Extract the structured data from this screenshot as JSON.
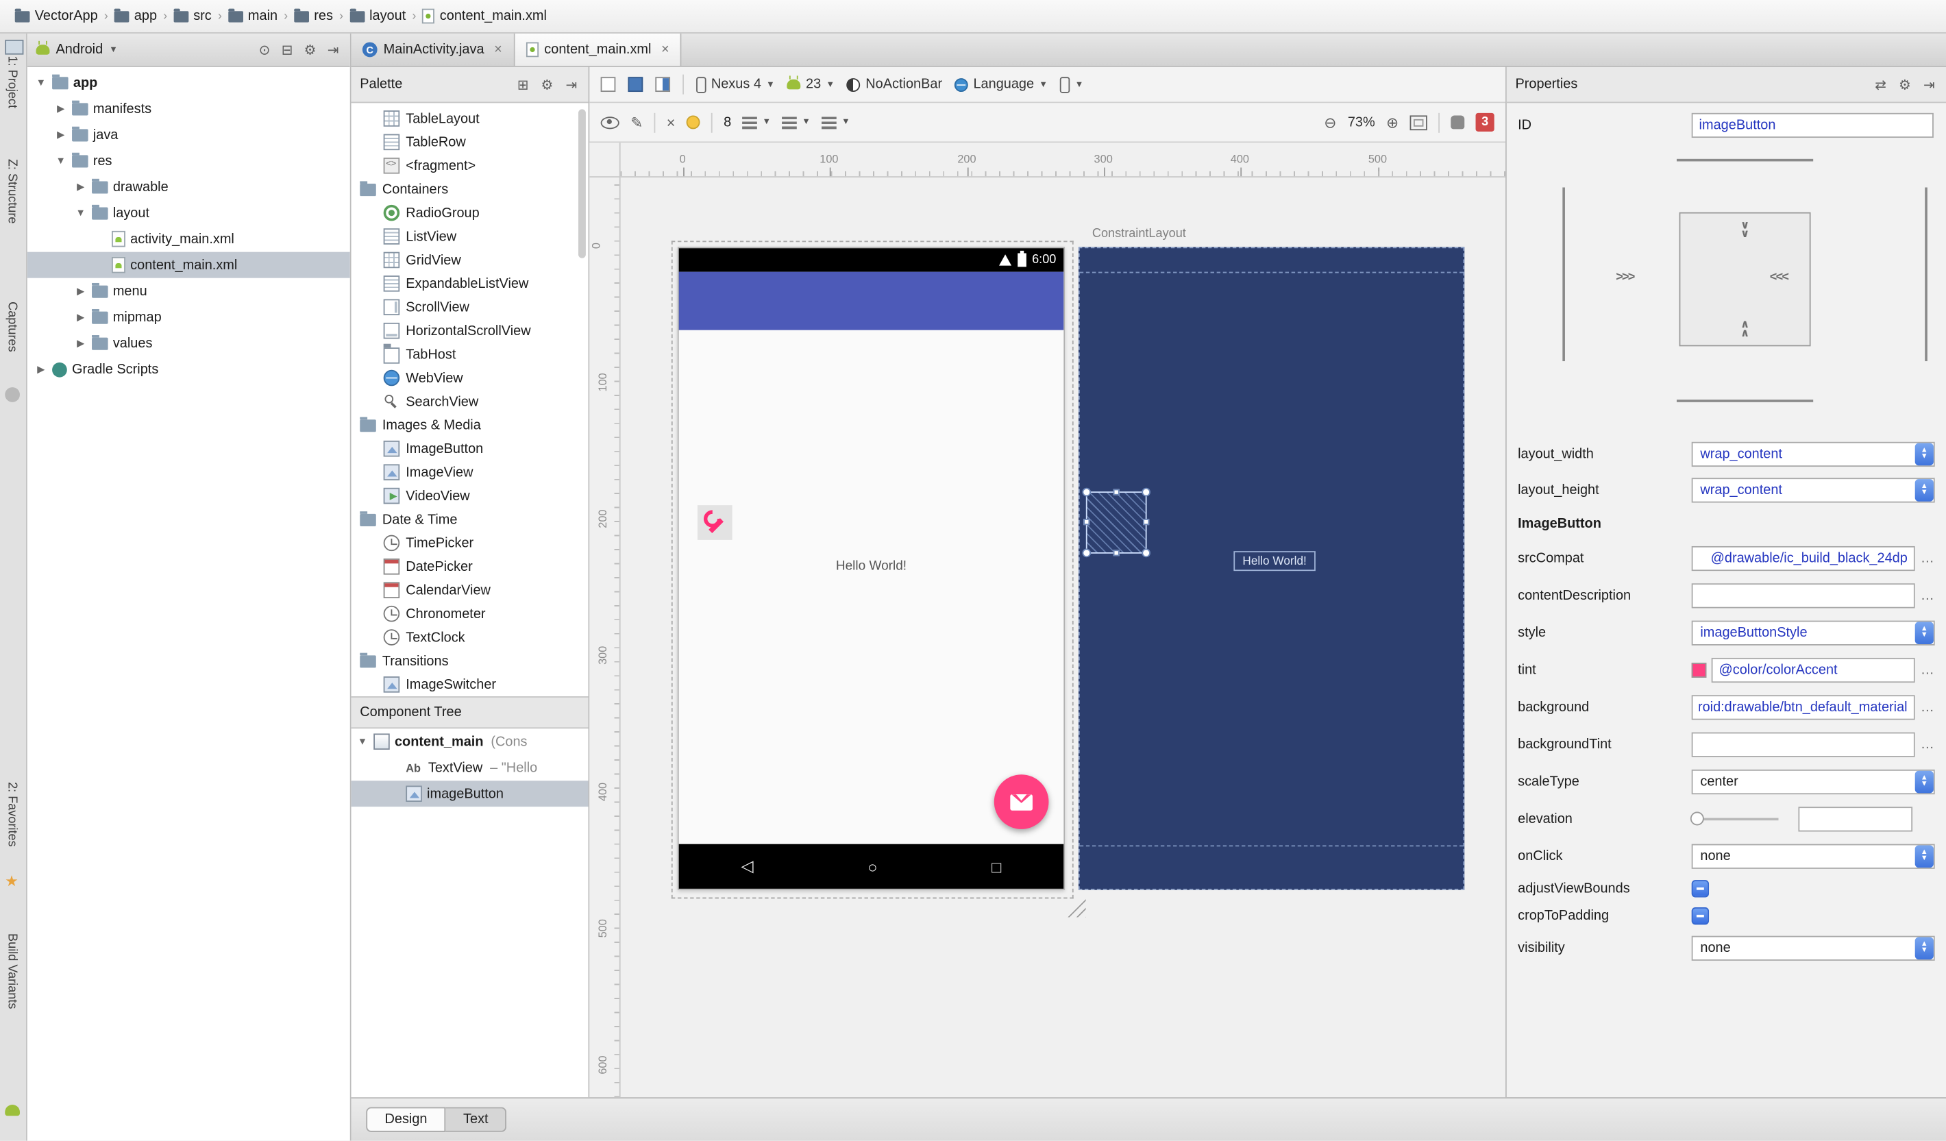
{
  "breadcrumbs": {
    "items": [
      "VectorApp",
      "app",
      "src",
      "main",
      "res",
      "layout",
      "content_main.xml"
    ]
  },
  "tool_strip": {
    "project": "1: Project",
    "structure": "Z: Structure",
    "captures": "Captures",
    "favorites": "2: Favorites",
    "build_variants": "Build Variants"
  },
  "project_panel": {
    "view": "Android",
    "tree": [
      {
        "label": "app"
      },
      {
        "label": "manifests"
      },
      {
        "label": "java"
      },
      {
        "label": "res"
      },
      {
        "label": "drawable"
      },
      {
        "label": "layout"
      },
      {
        "label": "activity_main.xml"
      },
      {
        "label": "content_main.xml"
      },
      {
        "label": "menu"
      },
      {
        "label": "mipmap"
      },
      {
        "label": "values"
      },
      {
        "label": "Gradle Scripts"
      }
    ]
  },
  "editor_tabs": {
    "tab1": "MainActivity.java",
    "tab2": "content_main.xml"
  },
  "palette": {
    "title": "Palette",
    "items": [
      "TableLayout",
      "TableRow",
      "<fragment>",
      "Containers",
      "RadioGroup",
      "ListView",
      "GridView",
      "ExpandableListView",
      "ScrollView",
      "HorizontalScrollView",
      "TabHost",
      "WebView",
      "SearchView",
      "Images & Media",
      "ImageButton",
      "ImageView",
      "VideoView",
      "Date & Time",
      "TimePicker",
      "DatePicker",
      "CalendarView",
      "Chronometer",
      "TextClock",
      "Transitions",
      "ImageSwitcher"
    ]
  },
  "component_tree": {
    "title": "Component Tree",
    "root_name": "content_main",
    "root_suffix": "(Cons",
    "child1_name": "TextView",
    "child1_suffix": "– \"Hello",
    "child2_name": "imageButton"
  },
  "design_toolbar": {
    "device": "Nexus 4",
    "api_level": "23",
    "theme": "NoActionBar",
    "locale": "Language",
    "default_margin": "8",
    "zoom_level": "73%",
    "error_count": "3"
  },
  "canvas": {
    "h_ruler": [
      "0",
      "100",
      "200",
      "300",
      "400",
      "500"
    ],
    "v_ruler": [
      "0",
      "100",
      "200",
      "300",
      "400",
      "500",
      "600"
    ],
    "status_time": "6:00",
    "hello_design": "Hello World!",
    "hello_blueprint": "Hello World!",
    "root_tag": "ConstraintLayout"
  },
  "properties": {
    "title": "Properties",
    "id_label": "ID",
    "id_value": "imageButton",
    "layout_width_label": "layout_width",
    "layout_width_value": "wrap_content",
    "layout_height_label": "layout_height",
    "layout_height_value": "wrap_content",
    "section": "ImageButton",
    "srcCompat_label": "srcCompat",
    "srcCompat_value": "@drawable/ic_build_black_24dp",
    "contentDescription_label": "contentDescription",
    "contentDescription_value": "",
    "style_label": "style",
    "style_value": "imageButtonStyle",
    "tint_label": "tint",
    "tint_value": "@color/colorAccent",
    "background_label": "background",
    "background_value": "@android:drawable/btn_default_material",
    "backgroundTint_label": "backgroundTint",
    "backgroundTint_value": "",
    "scaleType_label": "scaleType",
    "scaleType_value": "center",
    "elevation_label": "elevation",
    "elevation_value": "",
    "onClick_label": "onClick",
    "onClick_value": "none",
    "adjustViewBounds_label": "adjustViewBounds",
    "cropToPadding_label": "cropToPadding",
    "visibility_label": "visibility",
    "visibility_value": "none"
  },
  "bottom_bar": {
    "design_tab": "Design",
    "text_tab": "Text"
  }
}
